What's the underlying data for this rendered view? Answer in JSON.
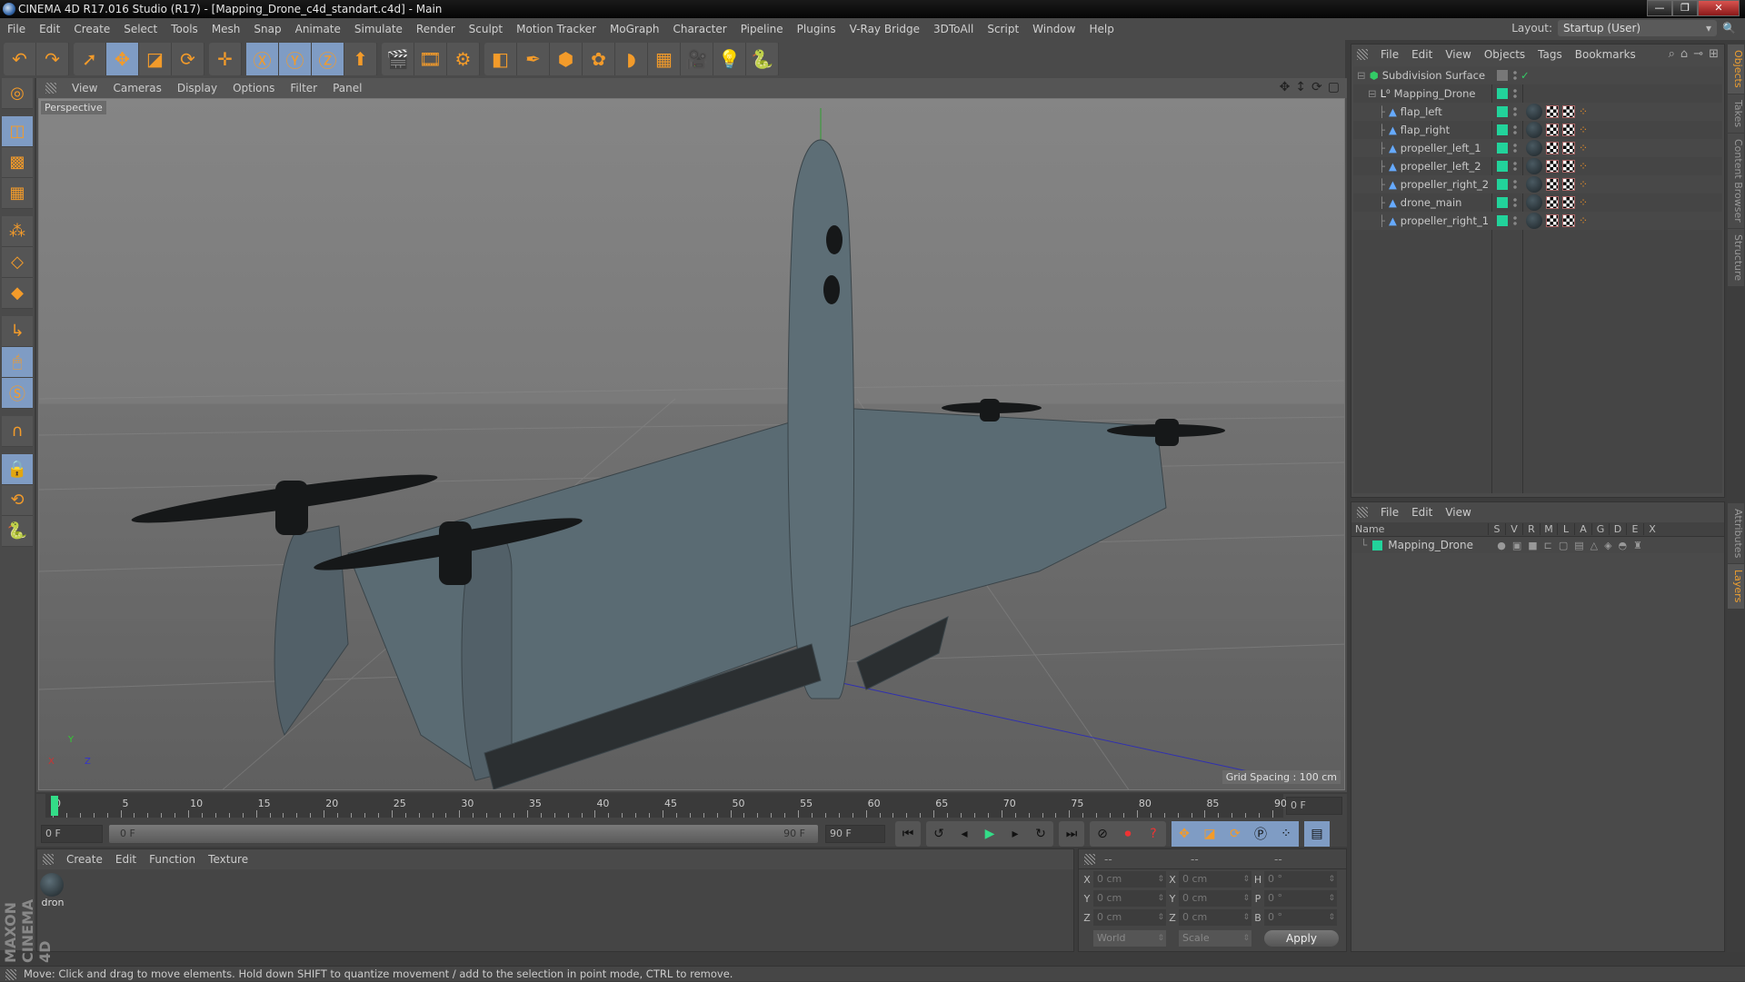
{
  "window": {
    "title": "CINEMA 4D R17.016 Studio (R17) - [Mapping_Drone_c4d_standart.c4d] - Main",
    "buttons": [
      "minimize",
      "restore",
      "close"
    ]
  },
  "menubar": [
    "File",
    "Edit",
    "Create",
    "Select",
    "Tools",
    "Mesh",
    "Snap",
    "Animate",
    "Simulate",
    "Render",
    "Sculpt",
    "Motion Tracker",
    "MoGraph",
    "Character",
    "Pipeline",
    "Plugins",
    "V-Ray Bridge",
    "3DToAll",
    "Script",
    "Window",
    "Help"
  ],
  "layout": {
    "label": "Layout:",
    "value": "Startup (User)"
  },
  "toolbar": {
    "groups": [
      [
        "undo-icon",
        "redo-icon"
      ],
      [
        "select-arrow-icon",
        "move-icon",
        "scale-icon",
        "rotate-icon"
      ],
      [
        "move-alt-icon"
      ],
      [
        "x-axis-icon",
        "y-axis-icon",
        "z-axis-icon",
        "coordinate-system-icon"
      ],
      [
        "render-view-icon",
        "render-picture-viewer-icon",
        "render-settings-icon"
      ],
      [
        "cube-icon",
        "pen-icon",
        "subdivision-icon",
        "mograph-cloner-icon",
        "deformer-icon",
        "floor-icon",
        "camera-icon",
        "light-icon",
        "python-icon"
      ]
    ]
  },
  "left_tools": [
    "make-editable-icon",
    "model-mode-icon",
    "texture-mode-icon",
    "workplane-icon",
    "points-mode-icon",
    "edges-mode-icon",
    "polygons-mode-icon",
    "axis-icon",
    "tweak-icon",
    "solo-icon",
    "magnet-icon",
    "lock-workplane-icon",
    "workplane-rotate-icon",
    "python-icon"
  ],
  "viewport": {
    "menu": [
      "View",
      "Cameras",
      "Display",
      "Options",
      "Filter",
      "Panel"
    ],
    "camera": "Perspective",
    "grid_spacing": "Grid Spacing : 100 cm",
    "axes": [
      "X",
      "Y",
      "Z"
    ]
  },
  "object_manager": {
    "menu": [
      "File",
      "Edit",
      "View",
      "Objects",
      "Tags",
      "Bookmarks"
    ],
    "objects": [
      {
        "name": "Subdivision Surface",
        "depth": 0,
        "type": "subdivision"
      },
      {
        "name": "Mapping_Drone",
        "depth": 1,
        "type": "null"
      },
      {
        "name": "flap_left",
        "depth": 2,
        "type": "mesh"
      },
      {
        "name": "flap_right",
        "depth": 2,
        "type": "mesh"
      },
      {
        "name": "propeller_left_1",
        "depth": 2,
        "type": "mesh"
      },
      {
        "name": "propeller_left_2",
        "depth": 2,
        "type": "mesh"
      },
      {
        "name": "propeller_right_2",
        "depth": 2,
        "type": "mesh"
      },
      {
        "name": "drone_main",
        "depth": 2,
        "type": "mesh"
      },
      {
        "name": "propeller_right_1",
        "depth": 2,
        "type": "mesh"
      }
    ]
  },
  "side_tabs_top": [
    "Objects",
    "Takes",
    "Content Browser",
    "Structure"
  ],
  "side_tabs_bottom": [
    "Attributes",
    "Layers"
  ],
  "layer_manager": {
    "menu": [
      "File",
      "Edit",
      "View"
    ],
    "columns": [
      "Name",
      "S",
      "V",
      "R",
      "M",
      "L",
      "A",
      "G",
      "D",
      "E",
      "X"
    ],
    "layers": [
      {
        "name": "Mapping_Drone",
        "color": "#22d39b"
      }
    ]
  },
  "timeline": {
    "ticks": [
      0,
      5,
      10,
      15,
      20,
      25,
      30,
      35,
      40,
      45,
      50,
      55,
      60,
      65,
      70,
      75,
      80,
      85,
      90
    ],
    "current_frame": "0 F",
    "start": "0 F",
    "range_start": "0 F",
    "range_end": "90 F",
    "end": "90 F"
  },
  "transport": [
    "go-start-icon",
    "prev-key-icon",
    "prev-frame-icon",
    "play-icon",
    "next-frame-icon",
    "next-key-icon",
    "go-end-icon",
    "motion-record-icon",
    "record-icon",
    "autokey-icon",
    "move-key-icon",
    "scale-key-icon",
    "rotate-key-icon",
    "param-key-icon",
    "pla-key-icon",
    "timeline-icon"
  ],
  "material_manager": {
    "menu": [
      "Create",
      "Edit",
      "Function",
      "Texture"
    ],
    "materials": [
      {
        "name": "dron"
      }
    ]
  },
  "coordinates": {
    "headers": [
      "--",
      "--",
      "--"
    ],
    "rows": [
      {
        "l1": "X",
        "v1": "0 cm",
        "l2": "X",
        "v2": "0 cm",
        "l3": "H",
        "v3": "0 °"
      },
      {
        "l1": "Y",
        "v1": "0 cm",
        "l2": "Y",
        "v2": "0 cm",
        "l3": "P",
        "v3": "0 °"
      },
      {
        "l1": "Z",
        "v1": "0 cm",
        "l2": "Z",
        "v2": "0 cm",
        "l3": "B",
        "v3": "0 °"
      }
    ],
    "mode": "World",
    "transform": "Scale",
    "apply": "Apply"
  },
  "brand": "MAXON CINEMA 4D",
  "status": "Move: Click and drag to move elements. Hold down SHIFT to quantize movement / add to the selection in point mode, CTRL to remove."
}
